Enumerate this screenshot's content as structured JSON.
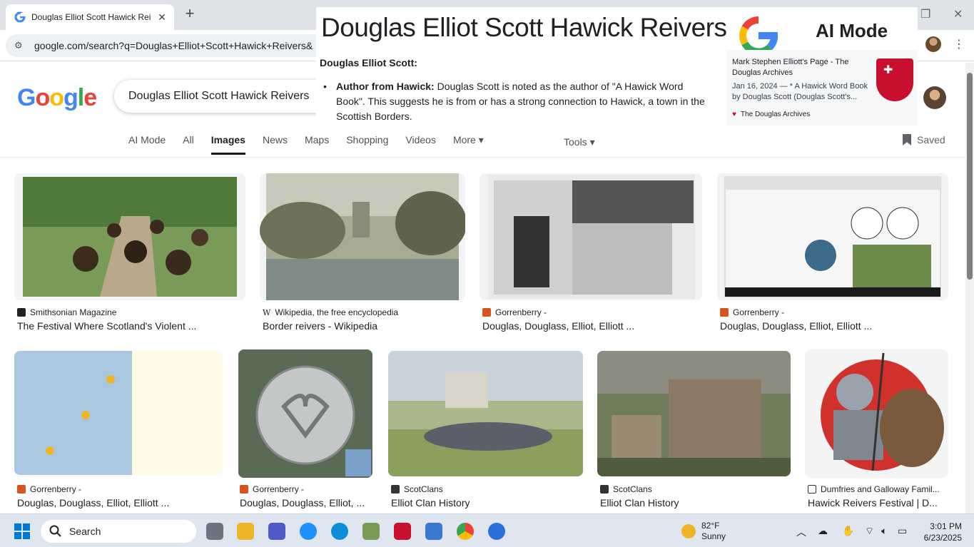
{
  "browser": {
    "tab_title": "Douglas Elliot Scott Hawick Rei",
    "tab_close": "✕",
    "new_tab": "+",
    "url": "google.com/search?q=Douglas+Elliot+Scott+Hawick+Reivers&",
    "menu": "⋮"
  },
  "google": {
    "logo": "Google",
    "query": "Douglas Elliot Scott Hawick Reivers"
  },
  "tabs": [
    "AI Mode",
    "All",
    "Images",
    "News",
    "Maps",
    "Shopping",
    "Videos",
    "More ▾"
  ],
  "tools_label": "Tools ▾",
  "saved_label": "Saved",
  "ai_overlay": {
    "title": "Douglas Elliot Scott Hawick Reivers",
    "mode_label": "AI Mode",
    "subheading": "Douglas Elliot Scott:",
    "bullet_bold": "Author from Hawick:",
    "bullet_text": " Douglas Scott is noted as the author of \"A Hawick Word Book\". This suggests he is from or has a strong connection to Hawick, a town in the Scottish Borders.",
    "card_title": "Mark Stephen Elliott's Page - The Douglas Archives",
    "card_desc": "Jan 16, 2024 — * A Hawick Word Book by Douglas Scott (Douglas Scott's...",
    "card_source": "The Douglas Archives"
  },
  "results": [
    {
      "source": "Smithsonian Magazine",
      "title": "The Festival Where Scotland's Violent ..."
    },
    {
      "source": "Wikipedia, the free encyclopedia",
      "title": "Border reivers - Wikipedia"
    },
    {
      "source": "Gorrenberry -",
      "title": "Douglas, Douglass, Elliot, Elliott ..."
    },
    {
      "source": "Gorrenberry -",
      "title": "Douglas, Douglass, Elliot, Elliott ..."
    },
    {
      "source": "Gorrenberry -",
      "title": "Douglas, Douglass, Elliot, Elliott ..."
    },
    {
      "source": "Gorrenberry -",
      "title": "Douglas, Douglass, Elliot, ..."
    },
    {
      "source": "ScotClans",
      "title": "Elliot Clan History"
    },
    {
      "source": "ScotClans",
      "title": "Elliot Clan History"
    },
    {
      "source": "Dumfries and Galloway Famil...",
      "title": "Hawick Reivers Festival | D..."
    }
  ],
  "taskbar": {
    "search_label": "Search",
    "temp": "82°F",
    "condition": "Sunny",
    "time": "3:01 PM",
    "date": "6/23/2025"
  }
}
